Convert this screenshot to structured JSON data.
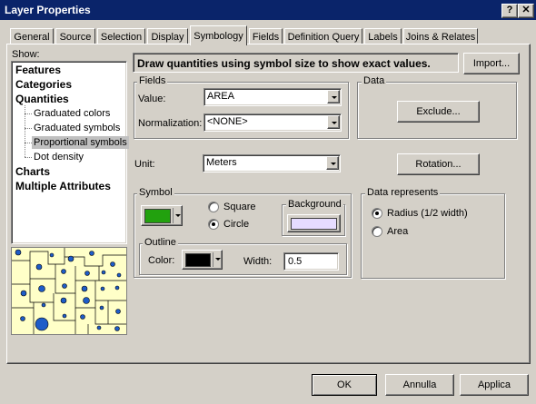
{
  "window": {
    "title": "Layer Properties",
    "help_glyph": "?",
    "close_glyph": "✕"
  },
  "tabs": [
    {
      "label": "General"
    },
    {
      "label": "Source"
    },
    {
      "label": "Selection"
    },
    {
      "label": "Display"
    },
    {
      "label": "Symbology",
      "active": true
    },
    {
      "label": "Fields"
    },
    {
      "label": "Definition Query"
    },
    {
      "label": "Labels"
    },
    {
      "label": "Joins & Relates"
    }
  ],
  "show": {
    "label": "Show:",
    "items": [
      {
        "label": "Features"
      },
      {
        "label": "Categories"
      },
      {
        "label": "Quantities"
      },
      {
        "label": "Graduated colors"
      },
      {
        "label": "Graduated symbols"
      },
      {
        "label": "Proportional symbols",
        "selected": true
      },
      {
        "label": "Dot density"
      },
      {
        "label": "Charts"
      },
      {
        "label": "Multiple Attributes"
      }
    ]
  },
  "description": "Draw quantities using symbol size to show exact values.",
  "import_button": "Import...",
  "fields": {
    "group_label": "Fields",
    "value_label": "Value:",
    "value": "AREA",
    "normalization_label": "Normalization:",
    "normalization": "<NONE>"
  },
  "data": {
    "group_label": "Data",
    "exclude_button": "Exclude..."
  },
  "unit": {
    "label": "Unit:",
    "value": "Meters"
  },
  "rotation_button": "Rotation...",
  "symbol": {
    "group_label": "Symbol",
    "fill_color": "#22a10e",
    "shape_options": [
      {
        "label": "Square",
        "checked": false
      },
      {
        "label": "Circle",
        "checked": true
      }
    ],
    "background_label": "Background",
    "background_color": "#e6dcff",
    "outline": {
      "group_label": "Outline",
      "color_label": "Color:",
      "color": "#000000",
      "width_label": "Width:",
      "width": "0.5"
    }
  },
  "data_represents": {
    "group_label": "Data represents",
    "options": [
      {
        "label": "Radius (1/2 width)",
        "checked": true
      },
      {
        "label": "Area",
        "checked": false
      }
    ]
  },
  "footer": {
    "ok": "OK",
    "cancel": "Annulla",
    "apply": "Applica"
  },
  "colors": {
    "map_land": "#ffffc8",
    "map_symbol": "#1e5cc8",
    "title_bar": "#0a246a"
  }
}
